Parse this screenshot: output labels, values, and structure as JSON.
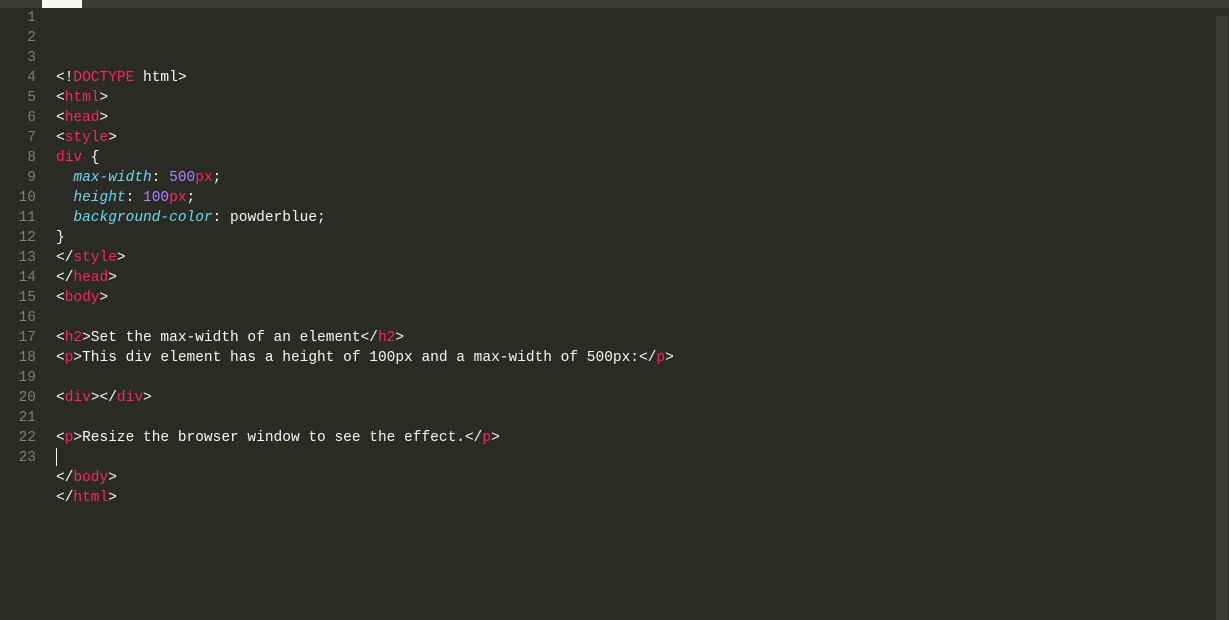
{
  "editor": {
    "line_count": 23,
    "cursor_line": 23,
    "lines": [
      {
        "num": 1,
        "tokens": [
          {
            "t": "<!",
            "c": "p-white"
          },
          {
            "t": "DOCTYPE",
            "c": "p-red"
          },
          {
            "t": " ",
            "c": "p-white"
          },
          {
            "t": "html",
            "c": "p-white"
          },
          {
            "t": ">",
            "c": "p-white"
          }
        ]
      },
      {
        "num": 2,
        "tokens": [
          {
            "t": "<",
            "c": "p-white"
          },
          {
            "t": "html",
            "c": "p-red"
          },
          {
            "t": ">",
            "c": "p-white"
          }
        ]
      },
      {
        "num": 3,
        "tokens": [
          {
            "t": "<",
            "c": "p-white"
          },
          {
            "t": "head",
            "c": "p-red"
          },
          {
            "t": ">",
            "c": "p-white"
          }
        ]
      },
      {
        "num": 4,
        "tokens": [
          {
            "t": "<",
            "c": "p-white"
          },
          {
            "t": "style",
            "c": "p-red"
          },
          {
            "t": ">",
            "c": "p-white"
          }
        ]
      },
      {
        "num": 5,
        "tokens": [
          {
            "t": "div",
            "c": "p-red"
          },
          {
            "t": " {",
            "c": "p-white"
          }
        ]
      },
      {
        "num": 6,
        "tokens": [
          {
            "t": "  ",
            "c": "p-white"
          },
          {
            "t": "max-width",
            "c": "p-blue"
          },
          {
            "t": ": ",
            "c": "p-white"
          },
          {
            "t": "500",
            "c": "p-purple"
          },
          {
            "t": "px",
            "c": "p-red"
          },
          {
            "t": ";",
            "c": "p-white"
          }
        ]
      },
      {
        "num": 7,
        "tokens": [
          {
            "t": "  ",
            "c": "p-white"
          },
          {
            "t": "height",
            "c": "p-blue"
          },
          {
            "t": ": ",
            "c": "p-white"
          },
          {
            "t": "100",
            "c": "p-purple"
          },
          {
            "t": "px",
            "c": "p-red"
          },
          {
            "t": ";",
            "c": "p-white"
          }
        ]
      },
      {
        "num": 8,
        "tokens": [
          {
            "t": "  ",
            "c": "p-white"
          },
          {
            "t": "background-color",
            "c": "p-blue"
          },
          {
            "t": ": powderblue;",
            "c": "p-white"
          }
        ]
      },
      {
        "num": 9,
        "tokens": [
          {
            "t": "}",
            "c": "p-white"
          }
        ]
      },
      {
        "num": 10,
        "tokens": [
          {
            "t": "</",
            "c": "p-white"
          },
          {
            "t": "style",
            "c": "p-red"
          },
          {
            "t": ">",
            "c": "p-white"
          }
        ]
      },
      {
        "num": 11,
        "tokens": [
          {
            "t": "</",
            "c": "p-white"
          },
          {
            "t": "head",
            "c": "p-red"
          },
          {
            "t": ">",
            "c": "p-white"
          }
        ]
      },
      {
        "num": 12,
        "tokens": [
          {
            "t": "<",
            "c": "p-white"
          },
          {
            "t": "body",
            "c": "p-red"
          },
          {
            "t": ">",
            "c": "p-white"
          }
        ]
      },
      {
        "num": 13,
        "tokens": []
      },
      {
        "num": 14,
        "tokens": [
          {
            "t": "<",
            "c": "p-white"
          },
          {
            "t": "h2",
            "c": "p-red"
          },
          {
            "t": ">Set the max-width of an element</",
            "c": "p-white"
          },
          {
            "t": "h2",
            "c": "p-red"
          },
          {
            "t": ">",
            "c": "p-white"
          }
        ]
      },
      {
        "num": 15,
        "tokens": [
          {
            "t": "<",
            "c": "p-white"
          },
          {
            "t": "p",
            "c": "p-red"
          },
          {
            "t": ">This div element has a height of 100px and a max-width of 500px:</",
            "c": "p-white"
          },
          {
            "t": "p",
            "c": "p-red"
          },
          {
            "t": ">",
            "c": "p-white"
          }
        ]
      },
      {
        "num": 16,
        "tokens": []
      },
      {
        "num": 17,
        "tokens": [
          {
            "t": "<",
            "c": "p-white"
          },
          {
            "t": "div",
            "c": "p-red"
          },
          {
            "t": "></",
            "c": "p-white"
          },
          {
            "t": "div",
            "c": "p-red"
          },
          {
            "t": ">",
            "c": "p-white"
          }
        ]
      },
      {
        "num": 18,
        "tokens": []
      },
      {
        "num": 19,
        "tokens": [
          {
            "t": "<",
            "c": "p-white"
          },
          {
            "t": "p",
            "c": "p-red"
          },
          {
            "t": ">Resize the browser window to see the effect.</",
            "c": "p-white"
          },
          {
            "t": "p",
            "c": "p-red"
          },
          {
            "t": ">",
            "c": "p-white"
          }
        ]
      },
      {
        "num": 20,
        "tokens": []
      },
      {
        "num": 21,
        "tokens": [
          {
            "t": "</",
            "c": "p-white"
          },
          {
            "t": "body",
            "c": "p-red"
          },
          {
            "t": ">",
            "c": "p-white"
          }
        ]
      },
      {
        "num": 22,
        "tokens": [
          {
            "t": "</",
            "c": "p-white"
          },
          {
            "t": "html",
            "c": "p-red"
          },
          {
            "t": ">",
            "c": "p-white"
          }
        ]
      },
      {
        "num": 23,
        "tokens": []
      }
    ]
  }
}
